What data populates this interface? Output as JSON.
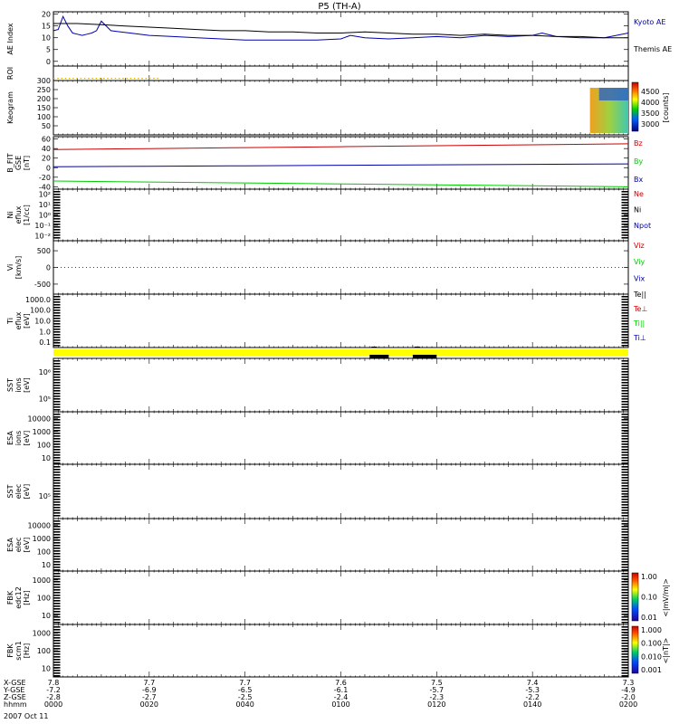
{
  "chart_data": {
    "type": "line",
    "title": "P5 (TH-A)",
    "x_ticks_minutes": [
      0,
      20,
      40,
      60,
      80,
      100,
      120
    ],
    "x_rows": [
      {
        "label": "X-GSE",
        "values": [
          "7.8",
          "7.7",
          "7.7",
          "7.6",
          "7.5",
          "7.4",
          "7.3"
        ]
      },
      {
        "label": "Y-GSE",
        "values": [
          "-7.2",
          "-6.9",
          "-6.5",
          "-6.1",
          "-5.7",
          "-5.3",
          "-4.9"
        ]
      },
      {
        "label": "Z-GSE",
        "values": [
          "-2.8",
          "-2.7",
          "-2.5",
          "-2.4",
          "-2.3",
          "-2.2",
          "-2.0"
        ]
      },
      {
        "label": "hhmm",
        "values": [
          "0000",
          "0020",
          "0040",
          "0100",
          "0120",
          "0140",
          "0200"
        ]
      }
    ],
    "date_label": "2007 Oct 11",
    "panels": [
      {
        "id": "ae",
        "ylabel": [
          "AE Index"
        ],
        "ylim": [
          -2,
          21
        ],
        "yticks": [
          "0",
          "5",
          "10",
          "15",
          "20"
        ],
        "ytick_values": [
          0,
          5,
          10,
          15,
          20
        ],
        "series": [
          {
            "name": "Kyoto AE",
            "color": "#0000aa",
            "x": [
              0,
              1,
              2,
              3,
              4,
              5,
              6,
              7,
              8,
              9,
              10,
              12,
              14,
              16,
              20,
              25,
              30,
              35,
              40,
              50,
              55,
              60,
              62,
              65,
              70,
              75,
              80,
              85,
              90,
              95,
              100,
              102,
              105,
              110,
              115,
              120
            ],
            "y": [
              13,
              13.5,
              19,
              15,
              12,
              11.5,
              11,
              11.5,
              12,
              13,
              17,
              13,
              12.5,
              12,
              11,
              10.5,
              10,
              9.5,
              9,
              9,
              9,
              9.5,
              11,
              10,
              9.5,
              10,
              10.5,
              10,
              11,
              10.5,
              11,
              12,
              10.5,
              10,
              10,
              12
            ]
          },
          {
            "name": "Themis AE",
            "color": "#000000",
            "x": [
              0,
              5,
              10,
              15,
              20,
              25,
              30,
              35,
              40,
              45,
              50,
              55,
              60,
              65,
              70,
              75,
              80,
              85,
              90,
              95,
              100,
              105,
              110,
              115,
              120
            ],
            "y": [
              16,
              16,
              15.5,
              15,
              14.5,
              14,
              13.5,
              13,
              13,
              12.5,
              12.5,
              12,
              12,
              12.5,
              12,
              11.5,
              11.5,
              11,
              11.5,
              11,
              11,
              10.5,
              10.5,
              10,
              10
            ]
          }
        ]
      },
      {
        "id": "roi",
        "ylabel": [
          "ROI"
        ],
        "yticks": [],
        "marker_range_minutes": [
          0,
          22
        ]
      },
      {
        "id": "keogram",
        "ylabel": [
          "Keogram"
        ],
        "ylim": [
          0,
          300
        ],
        "yticks": [
          "50",
          "100",
          "150",
          "200",
          "250",
          "300"
        ],
        "ytick_values": [
          50,
          100,
          150,
          200,
          250,
          300
        ],
        "image_range_minutes": [
          112,
          120
        ],
        "colorbar": {
          "label": "[counts]",
          "ticks": [
            "3000",
            "3500",
            "4000",
            "4500"
          ]
        }
      },
      {
        "id": "bfield",
        "ylabel": [
          "B_FIT",
          "GSE",
          "[nT]"
        ],
        "ylim": [
          -45,
          65
        ],
        "yticks": [
          "-40",
          "-20",
          "0",
          "20",
          "40",
          "60"
        ],
        "ytick_values": [
          -40,
          -20,
          0,
          20,
          40,
          60
        ],
        "series": [
          {
            "name": "Bz",
            "color": "#cc0000",
            "x": [
              0,
              20,
              40,
              60,
              80,
              100,
              120
            ],
            "y": [
              38,
              40,
              42,
              44,
              46,
              48,
              50
            ]
          },
          {
            "name": "By",
            "color": "#00cc00",
            "x": [
              0,
              20,
              40,
              60,
              80,
              100,
              120
            ],
            "y": [
              -28,
              -30,
              -32,
              -34,
              -36,
              -38,
              -40
            ]
          },
          {
            "name": "Bx",
            "color": "#0000aa",
            "x": [
              0,
              20,
              40,
              60,
              80,
              100,
              120
            ],
            "y": [
              2,
              3,
              4,
              5,
              6,
              7,
              8
            ]
          }
        ]
      },
      {
        "id": "ni",
        "ylabel": [
          "Ni",
          "eflux",
          "[1/cc]"
        ],
        "yticks": [
          "10²",
          "10¹",
          "10⁰",
          "10⁻¹",
          "10⁻²"
        ],
        "legend": [
          {
            "name": "Ne",
            "color": "#cc0000"
          },
          {
            "name": "Ni",
            "color": "#000000"
          },
          {
            "name": "Npot",
            "color": "#0000aa"
          }
        ]
      },
      {
        "id": "vi",
        "ylabel": [
          "Vi",
          "[km/s]"
        ],
        "ylim": [
          -800,
          800
        ],
        "yticks": [
          "500",
          "0",
          "-500"
        ],
        "ytick_values": [
          500,
          0,
          -500
        ],
        "legend": [
          {
            "name": "Viz",
            "color": "#cc0000"
          },
          {
            "name": "Viy",
            "color": "#00cc00"
          },
          {
            "name": "Vix",
            "color": "#0000aa"
          }
        ]
      },
      {
        "id": "ti",
        "ylabel": [
          "Ti",
          "eflux",
          "[eV]"
        ],
        "yticks": [
          "1000.0",
          "100.0",
          "10.0",
          "1.0",
          "0.1"
        ],
        "legend": [
          {
            "name": "Te||",
            "color": "#000000"
          },
          {
            "name": "Te⊥",
            "color": "#cc0000"
          },
          {
            "name": "Ti||",
            "color": "#00cc00"
          },
          {
            "name": "Ti⊥",
            "color": "#0000aa"
          }
        ]
      },
      {
        "id": "sst_i",
        "ylabel": [
          "SST",
          "ions",
          "[eV]"
        ],
        "yticks": [
          "10⁶",
          "10⁵"
        ]
      },
      {
        "id": "esa_i",
        "ylabel": [
          "ESA",
          "ions",
          "[eV]"
        ],
        "yticks": [
          "10000",
          "1000",
          "100",
          "10"
        ]
      },
      {
        "id": "sst_e",
        "ylabel": [
          "SST",
          "elec",
          "[eV]"
        ],
        "yticks": [
          "10⁵"
        ]
      },
      {
        "id": "esa_e",
        "ylabel": [
          "ESA",
          "elec",
          "[eV]"
        ],
        "yticks": [
          "10000",
          "1000",
          "100",
          "10"
        ]
      },
      {
        "id": "fbk1",
        "ylabel": [
          "FBK",
          "edc12",
          "[Hz]"
        ],
        "yticks": [
          "1000",
          "100",
          "10"
        ],
        "colorbar": {
          "label": "<|mV/m|>",
          "ticks": [
            "1.00",
            "0.10",
            "0.01"
          ]
        }
      },
      {
        "id": "fbk2",
        "ylabel": [
          "FBK",
          "scm1",
          "[Hz]"
        ],
        "yticks": [
          "1000",
          "100",
          "10"
        ],
        "colorbar": {
          "label": "<|nT|>",
          "ticks": [
            "1.000",
            "0.100",
            "0.010",
            "0.001"
          ]
        }
      }
    ]
  }
}
